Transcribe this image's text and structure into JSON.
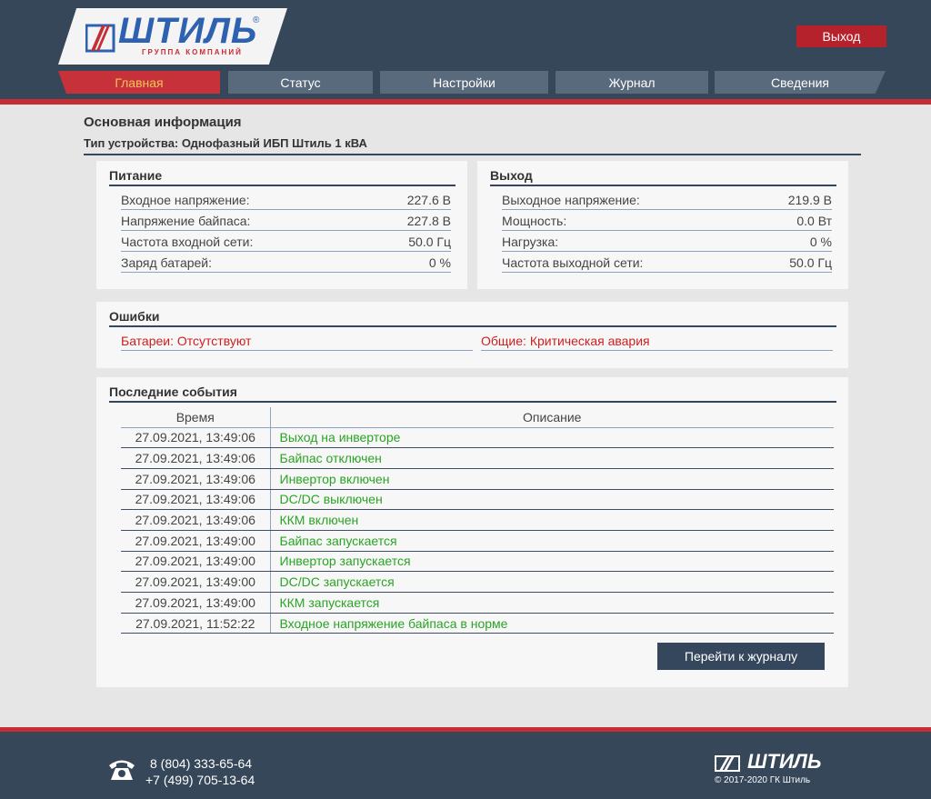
{
  "brand": {
    "name": "ШТИЛЬ",
    "subtitle": "ГРУППА КОМПАНИЙ",
    "registered": "®"
  },
  "header": {
    "logout_label": "Выход"
  },
  "nav": {
    "tabs": [
      {
        "label": "Главная",
        "active": true
      },
      {
        "label": "Статус",
        "active": false
      },
      {
        "label": "Настройки",
        "active": false
      },
      {
        "label": "Журнал",
        "active": false
      },
      {
        "label": "Сведения",
        "active": false
      }
    ]
  },
  "main": {
    "title": "Основная информация",
    "device_type": "Тип устройства: Однофазный ИБП Штиль 1 кВА"
  },
  "power": {
    "title": "Питание",
    "rows": [
      {
        "label": "Входное напряжение:",
        "value": "227.6 В"
      },
      {
        "label": "Напряжение байпаса:",
        "value": "227.8 В"
      },
      {
        "label": "Частота входной сети:",
        "value": "50.0 Гц"
      },
      {
        "label": "Заряд батарей:",
        "value": "0 %"
      }
    ]
  },
  "output": {
    "title": "Выход",
    "rows": [
      {
        "label": "Выходное напряжение:",
        "value": "219.9 В"
      },
      {
        "label": "Мощность:",
        "value": "0.0 Вт"
      },
      {
        "label": "Нагрузка:",
        "value": "0 %"
      },
      {
        "label": "Частота выходной сети:",
        "value": "50.0 Гц"
      }
    ]
  },
  "errors": {
    "title": "Ошибки",
    "items": [
      "Батареи: Отсутствуют",
      "Общие: Критическая авария"
    ]
  },
  "events": {
    "title": "Последние события",
    "columns": {
      "time": "Время",
      "description": "Описание"
    },
    "rows": [
      {
        "time": "27.09.2021, 13:49:06",
        "description": "Выход на инверторе"
      },
      {
        "time": "27.09.2021, 13:49:06",
        "description": "Байпас отключен"
      },
      {
        "time": "27.09.2021, 13:49:06",
        "description": "Инвертор включен"
      },
      {
        "time": "27.09.2021, 13:49:06",
        "description": "DC/DC выключен"
      },
      {
        "time": "27.09.2021, 13:49:06",
        "description": "ККМ включен"
      },
      {
        "time": "27.09.2021, 13:49:00",
        "description": "Байпас запускается"
      },
      {
        "time": "27.09.2021, 13:49:00",
        "description": "Инвертор запускается"
      },
      {
        "time": "27.09.2021, 13:49:00",
        "description": "DC/DC запускается"
      },
      {
        "time": "27.09.2021, 13:49:00",
        "description": "ККМ запускается"
      },
      {
        "time": "27.09.2021, 11:52:22",
        "description": "Входное напряжение байпаса в норме"
      }
    ],
    "journal_button": "Перейти к журналу"
  },
  "footer": {
    "phone1": "8  (804) 333-65-64",
    "phone2": "+7 (499) 705-13-64",
    "brand": "ШТИЛЬ",
    "copyright": "© 2017-2020 ГК Штиль"
  },
  "colors": {
    "header_bg": "#36475a",
    "accent_red": "#c62e35",
    "active_tab_text": "#f5c35a",
    "event_green": "#2aa424",
    "error_red": "#cc2020"
  },
  "icons": {
    "logo": "shtil-logo-icon",
    "phone": "phone-icon"
  }
}
